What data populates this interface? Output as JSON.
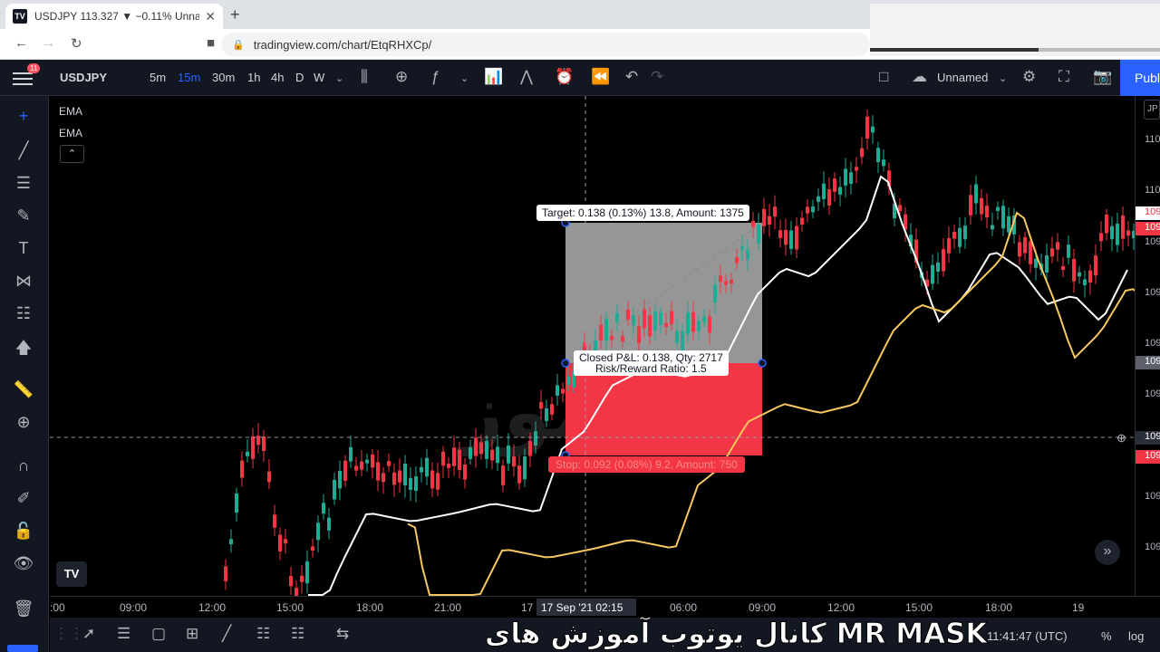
{
  "browser": {
    "tab_title": "USDJPY 113.327 ▼ −0.11% Unnam",
    "favicon": "TV",
    "url": "tradingview.com/chart/EtqRHXCp/"
  },
  "toolbar": {
    "badge": "11",
    "symbol": "USDJPY",
    "timeframes": [
      "5m",
      "15m",
      "30m",
      "1h",
      "4h",
      "D",
      "W"
    ],
    "active_timeframe": "15m",
    "layout_name": "Unnamed",
    "publish": "Publ"
  },
  "indicators": [
    "EMA",
    "EMA"
  ],
  "position": {
    "target": "Target: 0.138 (0.13%) 13.8, Amount: 1375",
    "closed_pnl": "Closed P&L: 0.138, Qty: 2717",
    "risk_reward": "Risk/Reward Ratio: 1.5",
    "stop": "Stop: 0.092 (0.08%) 9.2, Amount: 750"
  },
  "watermark": "آموز",
  "price_axis": {
    "top_label": "JP",
    "labels": [
      "110",
      "110",
      "109",
      "109",
      "109",
      "109",
      "109",
      "109",
      "109",
      "109",
      "109"
    ],
    "tags": [
      "109",
      "109",
      "109",
      "109",
      "109"
    ]
  },
  "time_axis": {
    "labels": [
      ":00",
      "09:00",
      "12:00",
      "15:00",
      "18:00",
      "21:00",
      "17",
      "06:00",
      "09:00",
      "12:00",
      "15:00",
      "18:00",
      "19"
    ],
    "crosshair_label": "17 Sep '21   02:15"
  },
  "bottom": {
    "clock": "11:41:47 (UTC)",
    "percent": "%",
    "log": "log",
    "caption": "کانال یوتوب آموزش های MR MASK"
  },
  "colors": {
    "up": "#22ab94",
    "down": "#f23645",
    "ema_fast": "#ffffff",
    "ema_slow": "#f6c85f",
    "accent": "#2962ff"
  }
}
